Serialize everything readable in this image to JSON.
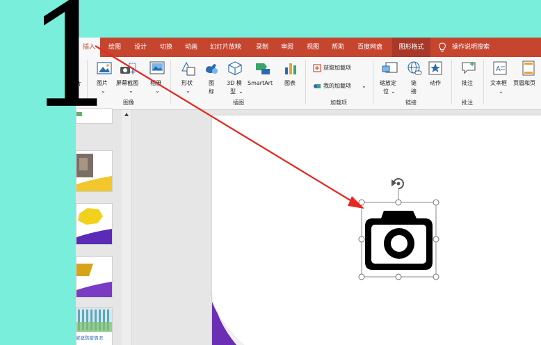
{
  "overlay": {
    "big_numeral": "1"
  },
  "ribbon_tabs": [
    "插入",
    "绘图",
    "设计",
    "切换",
    "动画",
    "幻灯片放映",
    "录制",
    "审阅",
    "视图",
    "帮助",
    "百度网盘",
    "图形格式",
    "操作说明搜索"
  ],
  "ribbon": {
    "left_partial_label": "片",
    "images": {
      "picture": "图片",
      "screenshot": "屏幕截图",
      "album": "相册",
      "group": "图像"
    },
    "illustrations": {
      "shapes": "形状",
      "icons_line1": "图",
      "icons_line2": "标",
      "model_line1": "3D 模",
      "model_line2": "型",
      "smartart": "SmartArt",
      "chart": "图表",
      "group": "插图"
    },
    "addins": {
      "get": "获取加载项",
      "mine": "我的加载项",
      "group": "加载项"
    },
    "links": {
      "zoom_line1": "缩放定",
      "zoom_line2": "位",
      "link_line1": "链",
      "link_line2": "接",
      "action": "动作",
      "group": "链接"
    },
    "comments": {
      "comment": "批注",
      "group": "批注"
    },
    "text": {
      "textbox": "文本框",
      "header": "页眉和页"
    }
  },
  "thumbnail_caption": "家庭防疫情况",
  "colors": {
    "tab_bar": "#C6452F",
    "arrow": "#E8261F",
    "background": "#79EEDB"
  }
}
